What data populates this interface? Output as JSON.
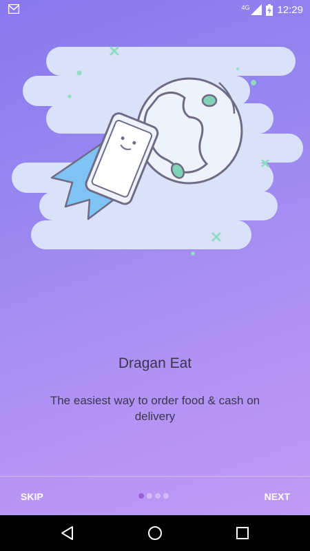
{
  "status_bar": {
    "network_label": "4G",
    "time": "12:29",
    "icons": [
      "gmail-icon",
      "signal-icon",
      "battery-charging-icon"
    ]
  },
  "onboarding": {
    "title": "Dragan Eat",
    "subtitle": "The easiest way to order food & cash on delivery",
    "page_indicator": {
      "total": 4,
      "active": 1
    }
  },
  "bottom_nav": {
    "skip_label": "SKIP",
    "next_label": "NEXT"
  },
  "system_nav": {
    "icons": [
      "back-icon",
      "home-icon",
      "recents-icon"
    ]
  },
  "colors": {
    "gradient_top": "#8a78ee",
    "gradient_bottom": "#c29cf6",
    "cloud": "#d9e2f8",
    "outline": "#6f6a86",
    "accent_green": "#7fd3b6",
    "rocket_flame": "#7ec3f3",
    "active_dot": "#9b5fd4"
  }
}
